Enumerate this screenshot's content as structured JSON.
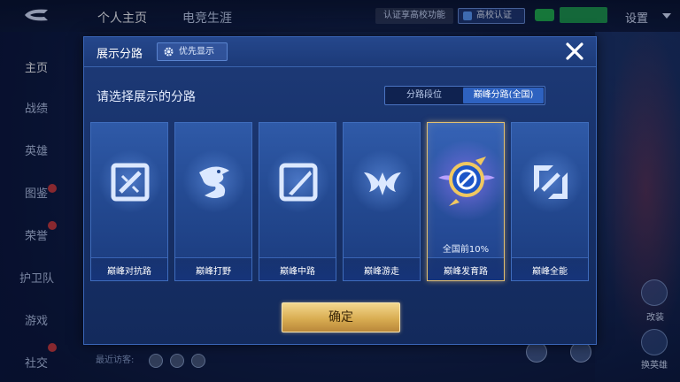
{
  "topbar": {
    "tabs": [
      "个人主页",
      "电竞生涯"
    ],
    "verify_text": "认证享高校功能",
    "school_btn": "高校认证",
    "settings": "设置"
  },
  "sidebar": {
    "items": [
      "主页",
      "战绩",
      "英雄",
      "图鉴",
      "荣誉",
      "护卫队",
      "游戏",
      "社交"
    ]
  },
  "bottom": {
    "recent_visitors": "最近访客:"
  },
  "right_panel": {
    "labels": [
      "改装",
      "换英雄"
    ]
  },
  "modal": {
    "title": "展示分路",
    "priority_button": "优先显示",
    "prompt": "请选择展示的分路",
    "segments": [
      "分路段位",
      "巅峰分路(全国)"
    ],
    "selected_segment": "巅峰分路(全国)",
    "cards": [
      {
        "label": "巅峰对抗路",
        "icon": "sword-shield-icon",
        "note": ""
      },
      {
        "label": "巅峰打野",
        "icon": "dragon-icon",
        "note": ""
      },
      {
        "label": "巅峰中路",
        "icon": "staff-icon",
        "note": ""
      },
      {
        "label": "巅峰游走",
        "icon": "wings-icon",
        "note": ""
      },
      {
        "label": "巅峰发育路",
        "icon": "marksman-badge-icon",
        "note": "全国前10%"
      },
      {
        "label": "巅峰全能",
        "icon": "all-round-icon",
        "note": ""
      }
    ],
    "selected_card": "巅峰发育路",
    "confirm_button": "确定"
  },
  "colors": {
    "panel": "#1d3a78",
    "accent_gold": "#d9ad52",
    "selected_segment": "#2e62c0"
  }
}
